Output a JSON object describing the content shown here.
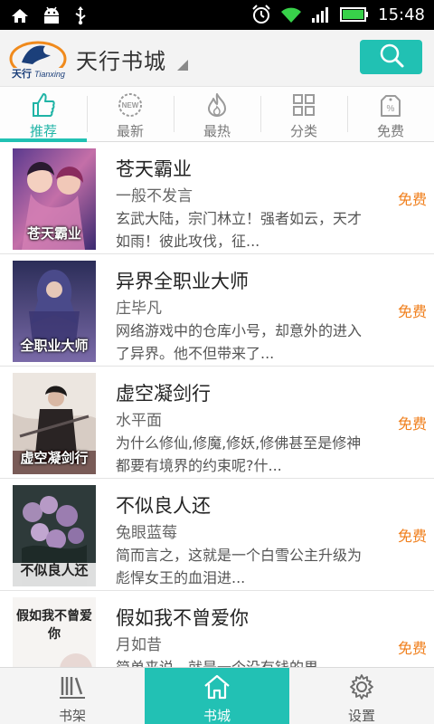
{
  "status_bar": {
    "time": "15:48",
    "icons": [
      "home-icon",
      "android-icon",
      "usb-icon",
      "alarm-icon",
      "wifi-icon",
      "signal-icon",
      "battery-icon"
    ]
  },
  "app_bar": {
    "logo_text": "天行 Tianxing",
    "title": "天行书城",
    "search_icon": "search-icon",
    "accent_color": "#21c1b3"
  },
  "tabs": [
    {
      "label": "推荐",
      "icon": "thumbs-up-icon",
      "active": true
    },
    {
      "label": "最新",
      "icon": "new-badge-icon",
      "active": false
    },
    {
      "label": "最热",
      "icon": "flame-icon",
      "active": false
    },
    {
      "label": "分类",
      "icon": "grid-icon",
      "active": false
    },
    {
      "label": "免费",
      "icon": "percent-tag-icon",
      "active": false
    }
  ],
  "books": [
    {
      "title": "苍天霸业",
      "author": "一般不发言",
      "desc": "玄武大陆，宗门林立！强者如云，天才如雨！彼此攻伐，征...",
      "price": "免费",
      "cover_text": "苍天霸业"
    },
    {
      "title": "异界全职业大师",
      "author": "庄毕凡",
      "desc": "网络游戏中的仓库小号，却意外的进入了异界。他不但带来了...",
      "price": "免费",
      "cover_text": "全职业大师"
    },
    {
      "title": "虚空凝剑行",
      "author": "水平面",
      "desc": "为什么修仙,修魔,修妖,修佛甚至是修神都要有境界的约束呢?什...",
      "price": "免费",
      "cover_text": "虚空凝剑行"
    },
    {
      "title": "不似良人还",
      "author": "兔眼蓝莓",
      "desc": "简而言之，这就是一个白雪公主升级为彪悍女王的血泪进...",
      "price": "免费",
      "cover_text": "不似良人还"
    },
    {
      "title": "假如我不曾爱你",
      "author": "月如昔",
      "desc": "简单来说，就是一个没有钱的男...",
      "price": "免费",
      "cover_text": "假如我不曾爱你"
    }
  ],
  "bottom_nav": [
    {
      "label": "书架",
      "icon": "bookshelf-icon",
      "active": false
    },
    {
      "label": "书城",
      "icon": "home-icon",
      "active": true
    },
    {
      "label": "设置",
      "icon": "gear-icon",
      "active": false
    }
  ]
}
